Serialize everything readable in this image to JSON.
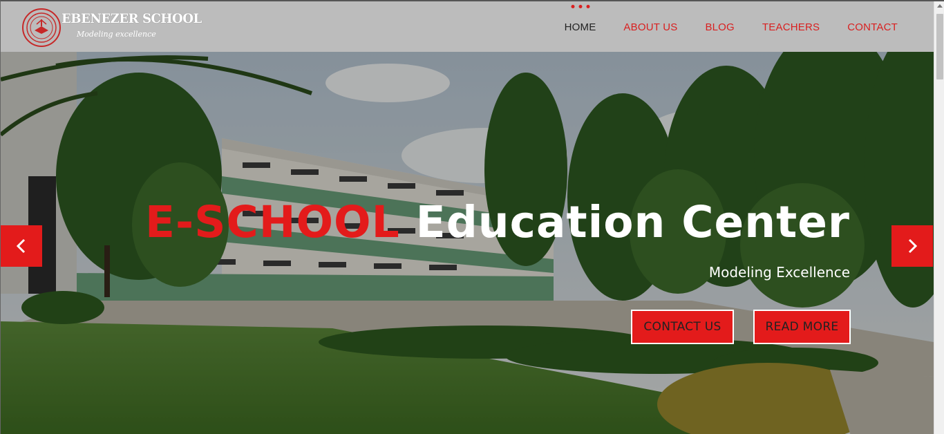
{
  "brand": {
    "name": "EBENEZER SCHOOL",
    "tagline": "Modeling excellence"
  },
  "nav": {
    "items": [
      {
        "label": "HOME",
        "active": true
      },
      {
        "label": "ABOUT US"
      },
      {
        "label": "BLOG"
      },
      {
        "label": "TEACHERS"
      },
      {
        "label": "CONTACT"
      }
    ]
  },
  "hero": {
    "title_accent": "E-SCHOOL",
    "title_rest": "Education Center",
    "subtitle": "Modeling Excellence",
    "buttons": {
      "contact": "CONTACT US",
      "read_more": "READ MORE"
    },
    "arrows": {
      "prev_icon": "chevron-left-icon",
      "next_icon": "chevron-right-icon"
    }
  },
  "colors": {
    "accent": "#e31b1b",
    "header_bg": "#bcbcbc",
    "nav_active": "#222222"
  }
}
